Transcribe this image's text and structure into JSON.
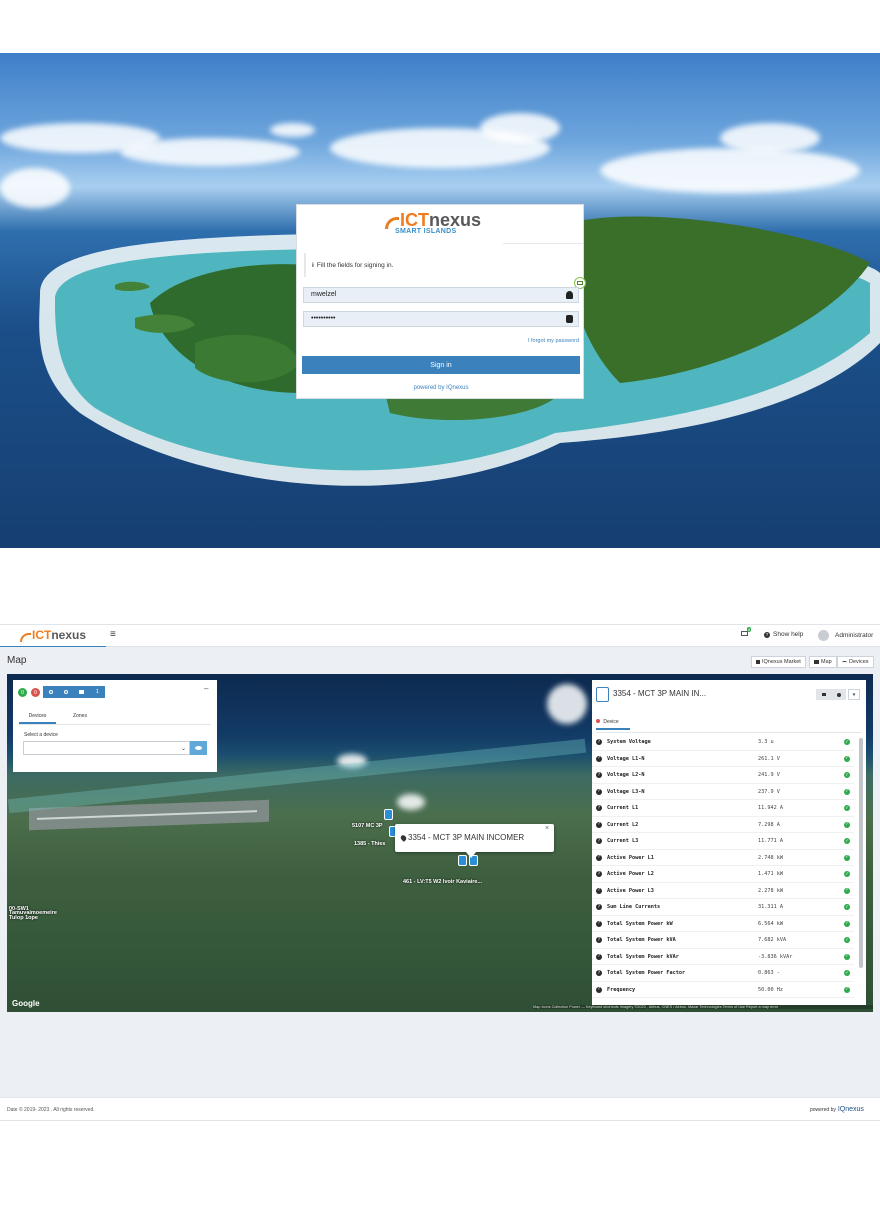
{
  "login": {
    "logo_ict": "ICT",
    "logo_nexus": "nexus",
    "logo_sub": "SMART ISLANDS",
    "info_text": "Fill the fields for signing in.",
    "username_value": "mwelzel",
    "password_value": "••••••••••",
    "forgot_link": "I forgot my password",
    "sign_in_label": "Sign in",
    "powered_by": "powered by IQnexus"
  },
  "app": {
    "header": {
      "logo_ict": "ICT",
      "logo_nexus": "nexus",
      "menu_icon": "≡",
      "notif_count": "8",
      "show_help": "Show help",
      "user": "Administrator"
    },
    "page_title": "Map",
    "top_buttons": [
      "IQnexus Market",
      "Map",
      "Devices"
    ],
    "map_panel": {
      "badge_green": "0",
      "badge_red": "0",
      "toolbar_count": "1",
      "collapse": "–",
      "tabs": [
        "Devices",
        "Zones"
      ],
      "select_label": "Select a device"
    },
    "popup": {
      "title": "3354 - MCT 3P MAIN INCOMER",
      "close": "×"
    },
    "map_labels": [
      "5107 MC 3P",
      "1385 - Thies",
      "461 - LV:T5 W2 Ivoir Kaviaire...",
      "00-SW1",
      "Tamuvaimoemeire",
      "Tulop 1ope"
    ],
    "google": "Google",
    "attribution": "Map Icons Collection Power — Keyboard shortcuts    Imagery ©2023 , Airbus, CNES / Airbus, Maxar Technologies  Terms of Use   Report a map error",
    "device_panel": {
      "title": "3354 - MCT 3P  MAIN IN...",
      "tab": "Device",
      "rows": [
        {
          "label": "System Voltage",
          "value": "3.3 u"
        },
        {
          "label": "Voltage L1-N",
          "value": "261.1 V"
        },
        {
          "label": "Voltage L2-N",
          "value": "241.9 V"
        },
        {
          "label": "Voltage L3-N",
          "value": "237.9 V"
        },
        {
          "label": "Current L1",
          "value": "11.942 A"
        },
        {
          "label": "Current L2",
          "value": "7.298 A"
        },
        {
          "label": "Current L3",
          "value": "11.771 A"
        },
        {
          "label": "Active Power L1",
          "value": "2.748 kW"
        },
        {
          "label": "Active Power L2",
          "value": "1.471 kW"
        },
        {
          "label": "Active Power L3",
          "value": "2.278 kW"
        },
        {
          "label": "Sum Line Currents",
          "value": "31.311 A"
        },
        {
          "label": "Total System Power kW",
          "value": "6.564 kW"
        },
        {
          "label": "Total System Power kVA",
          "value": "7.682 kVA"
        },
        {
          "label": "Total System Power kVAr",
          "value": "-3.836 kVAr"
        },
        {
          "label": "Total System Power Factor",
          "value": "0.863 -"
        },
        {
          "label": "Frequency",
          "value": "50.00 Hz"
        }
      ]
    },
    "footer": {
      "left": "Date © 2019- 2023 . All rights reserved.",
      "right_prefix": "powered by",
      "right_brand": "IQnexus"
    }
  },
  "colors": {
    "accent": "#3b82bd",
    "brand_orange": "#f07c1f",
    "ok_green": "#2eaa4a",
    "danger_red": "#d9534f"
  }
}
